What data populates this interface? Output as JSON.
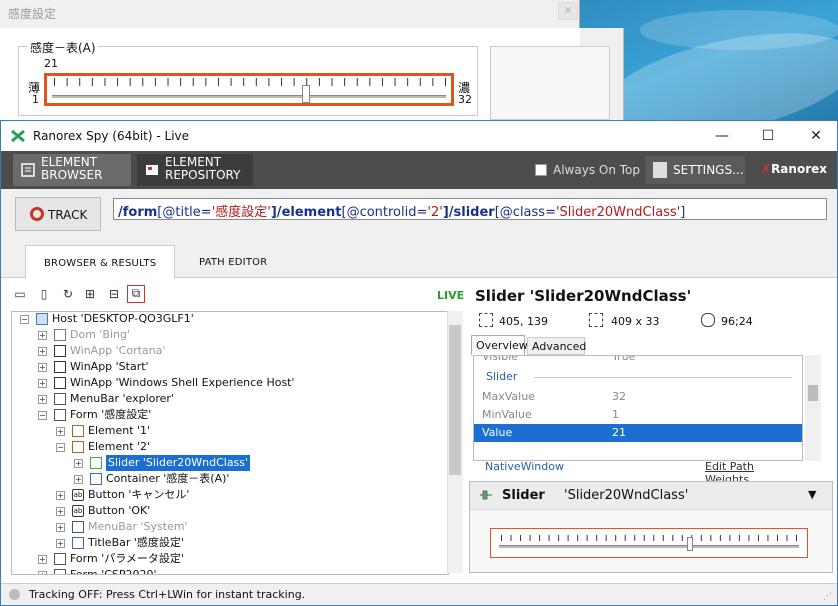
{
  "sensitivity_dialog": {
    "title": "感度設定",
    "close_glyph": "×",
    "group_label": "感度－表(A)",
    "value_top": "21",
    "thin": "薄",
    "min_value": "1",
    "thick": "濃",
    "max_value": "32",
    "slider_value": 21
  },
  "spy": {
    "title": "Ranorex Spy (64bit) - Live",
    "window_buttons": {
      "min": "—",
      "max": "☐",
      "close": "✕"
    },
    "toolbar": {
      "element_browser_line1": "ELEMENT",
      "element_browser_line2": "BROWSER",
      "element_repository_line1": "ELEMENT",
      "element_repository_line2": "REPOSITORY",
      "always_on_top": "Always On Top",
      "settings": "SETTINGS...",
      "brand_x": "✗",
      "brand": "Ranorex"
    },
    "track_label": "TRACK",
    "path": {
      "p1": "/",
      "p2": "form",
      "p3": "[",
      "p4": "@title",
      "p5": "=",
      "p6": "'感度設定'",
      "p7": "]/",
      "p8": "element",
      "p9": "[",
      "p10": "@controlid",
      "p11": "=",
      "p12": "'2'",
      "p13": "]/",
      "p14": "slider",
      "p15": "[",
      "p16": "@class",
      "p17": "=",
      "p18": "'Slider20WndClass'",
      "p19": "]"
    },
    "tabs": {
      "browser": "BROWSER & RESULTS",
      "path_editor": "PATH EDITOR"
    },
    "live_label": "LIVE",
    "tree": [
      {
        "label": "Host 'DESKTOP-QO3GLF1'",
        "gray": false
      },
      {
        "label": "Dom 'Bing'",
        "gray": true
      },
      {
        "label": "WinApp 'Cortana'",
        "gray": true
      },
      {
        "label": "WinApp 'Start'",
        "gray": false
      },
      {
        "label": "WinApp 'Windows Shell Experience Host'",
        "gray": false
      },
      {
        "label": "MenuBar 'explorer'",
        "gray": false
      },
      {
        "label": "Form '感度設定'",
        "gray": false
      },
      {
        "label": "Element '1'",
        "gray": false
      },
      {
        "label": "Element '2'",
        "gray": false
      },
      {
        "label": "Slider 'Slider20WndClass'",
        "gray": false
      },
      {
        "label": "Container '感度－表(A)'",
        "gray": false
      },
      {
        "label": "Button 'キャンセル'",
        "gray": false
      },
      {
        "label": "Button 'OK'",
        "gray": false
      },
      {
        "label": "MenuBar 'System'",
        "gray": true
      },
      {
        "label": "TitleBar '感度設定'",
        "gray": false
      },
      {
        "label": "Form 'パラメータ設定'",
        "gray": false
      },
      {
        "label": "Form 'CSP2020'",
        "gray": false
      }
    ],
    "details": {
      "title": "Slider 'Slider20WndClass'",
      "location": "405, 139",
      "size": "409 x 33",
      "cursor": "96;24",
      "tab_overview": "Overview",
      "tab_advanced": "Advanced",
      "visible_label": "Visible",
      "visible_value": "True",
      "section_slider": "Slider",
      "max_label": "MaxValue",
      "max_value": "32",
      "min_label": "MinValue",
      "min_value": "1",
      "value_label": "Value",
      "value_value": "21",
      "native_window": "NativeWindow",
      "edit_path_weights": "Edit Path Weights...",
      "detail_role": "Slider",
      "detail_name": "'Slider20WndClass'",
      "detail_chev": "▼"
    },
    "status": "Tracking OFF: Press Ctrl+LWin for instant tracking."
  },
  "colors": {
    "highlight": "#e0551f",
    "selection": "#1a6fd1",
    "toolbar": "#4d4d4d"
  }
}
